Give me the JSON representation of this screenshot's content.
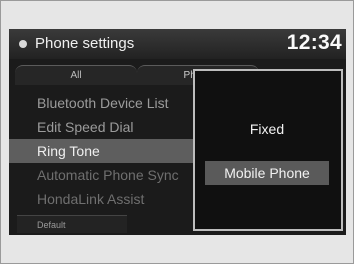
{
  "header": {
    "title": "Phone settings",
    "clock": "12:34"
  },
  "tabs": [
    {
      "label": "All"
    },
    {
      "label": "Phone"
    }
  ],
  "list": {
    "items": [
      {
        "label": "Bluetooth Device List"
      },
      {
        "label": "Edit Speed Dial"
      },
      {
        "label": "Ring Tone"
      },
      {
        "label": "Automatic Phone Sync"
      },
      {
        "label": "HondaLink Assist"
      }
    ],
    "selected_index": 2
  },
  "footer": {
    "default_label": "Default"
  },
  "popup": {
    "options": [
      {
        "label": "Fixed"
      },
      {
        "label": "Mobile Phone"
      }
    ],
    "selected_label": "Mobile Phone"
  }
}
